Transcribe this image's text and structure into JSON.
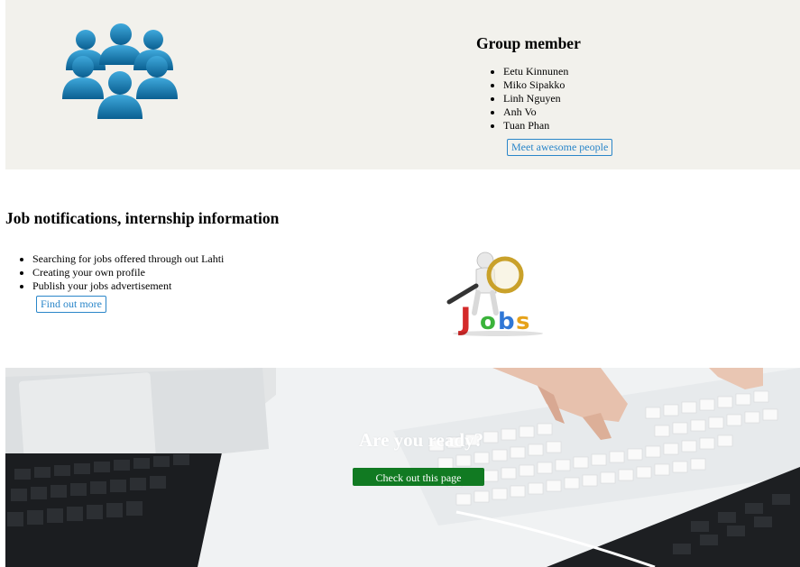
{
  "group": {
    "title": "Group member",
    "members": [
      "Eetu Kinnunen",
      "Miko Sipakko",
      "Linh Nguyen",
      "Anh Vo",
      "Tuan Phan"
    ],
    "button_label": "Meet awesome people",
    "image_icon": "people-group-icon"
  },
  "jobs": {
    "title": "Job notifications, internship information",
    "items": [
      "Searching for jobs offered through out Lahti",
      "Creating your own profile",
      "Publish your jobs advertisement"
    ],
    "button_label": "Find out more",
    "image_text": "Jobs"
  },
  "hero": {
    "title": "Are you ready?",
    "button_label": "Check out this page"
  },
  "colors": {
    "band_bg": "#f2f1ec",
    "link_blue": "#2a86c9",
    "cta_green": "#117a22",
    "people_blue": "#0e6fa3"
  }
}
